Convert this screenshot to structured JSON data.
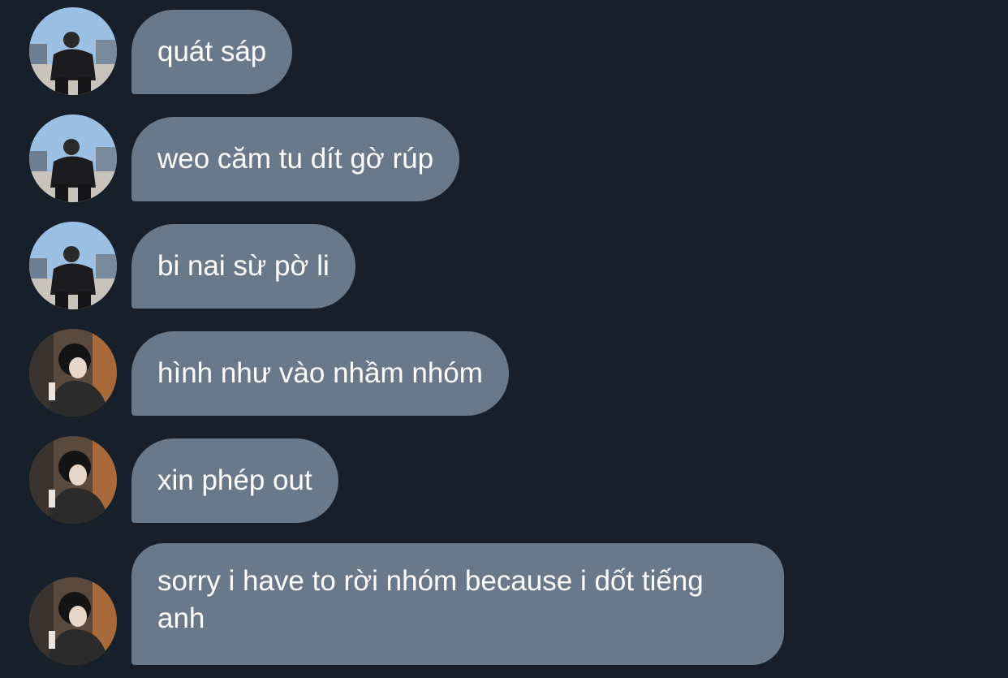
{
  "messages": [
    {
      "text": "quát sáp",
      "avatar": "user-a"
    },
    {
      "text": "weo căm tu dít gờ rúp",
      "avatar": "user-a"
    },
    {
      "text": "bi nai sừ pờ li",
      "avatar": "user-a"
    },
    {
      "text": "hình như vào nhầm nhóm",
      "avatar": "user-b"
    },
    {
      "text": "xin phép out",
      "avatar": "user-b"
    },
    {
      "text": "sorry i have to rời nhóm because i dốt tiếng anh",
      "avatar": "user-b"
    }
  ],
  "colors": {
    "background": "#17202a",
    "bubble": "#69798a",
    "text": "#ffffff"
  }
}
